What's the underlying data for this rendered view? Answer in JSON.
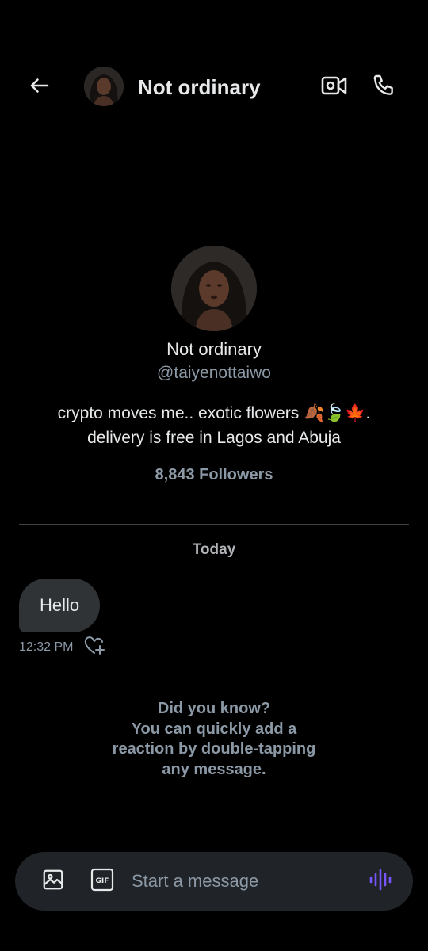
{
  "header": {
    "title": "Not ordinary",
    "back_icon": "arrow-left-icon",
    "video_icon": "video-camera-icon",
    "call_icon": "phone-icon"
  },
  "profile": {
    "name": "Not ordinary",
    "handle": "@taiyenottaiwo",
    "bio": "crypto moves me.. exotic flowers 🍂🍃🍁. delivery is free in Lagos and Abuja",
    "followers": "8,843 Followers"
  },
  "conversation": {
    "date_separator": "Today",
    "messages": [
      {
        "text": "Hello",
        "time": "12:32 PM",
        "direction": "incoming"
      }
    ]
  },
  "tip": {
    "title": "Did you know?",
    "body": "You can quickly add a reaction by double-tapping any message."
  },
  "composer": {
    "placeholder": "Start a message",
    "media_icon": "image-icon",
    "gif_icon": "gif-icon",
    "voice_icon": "voice-waveform-icon"
  },
  "colors": {
    "background": "#000000",
    "text_primary": "#e7e9ea",
    "text_secondary": "#8b98a5",
    "bubble": "#2f3336",
    "composer": "#202327",
    "accent_voice": "#7856ff"
  }
}
